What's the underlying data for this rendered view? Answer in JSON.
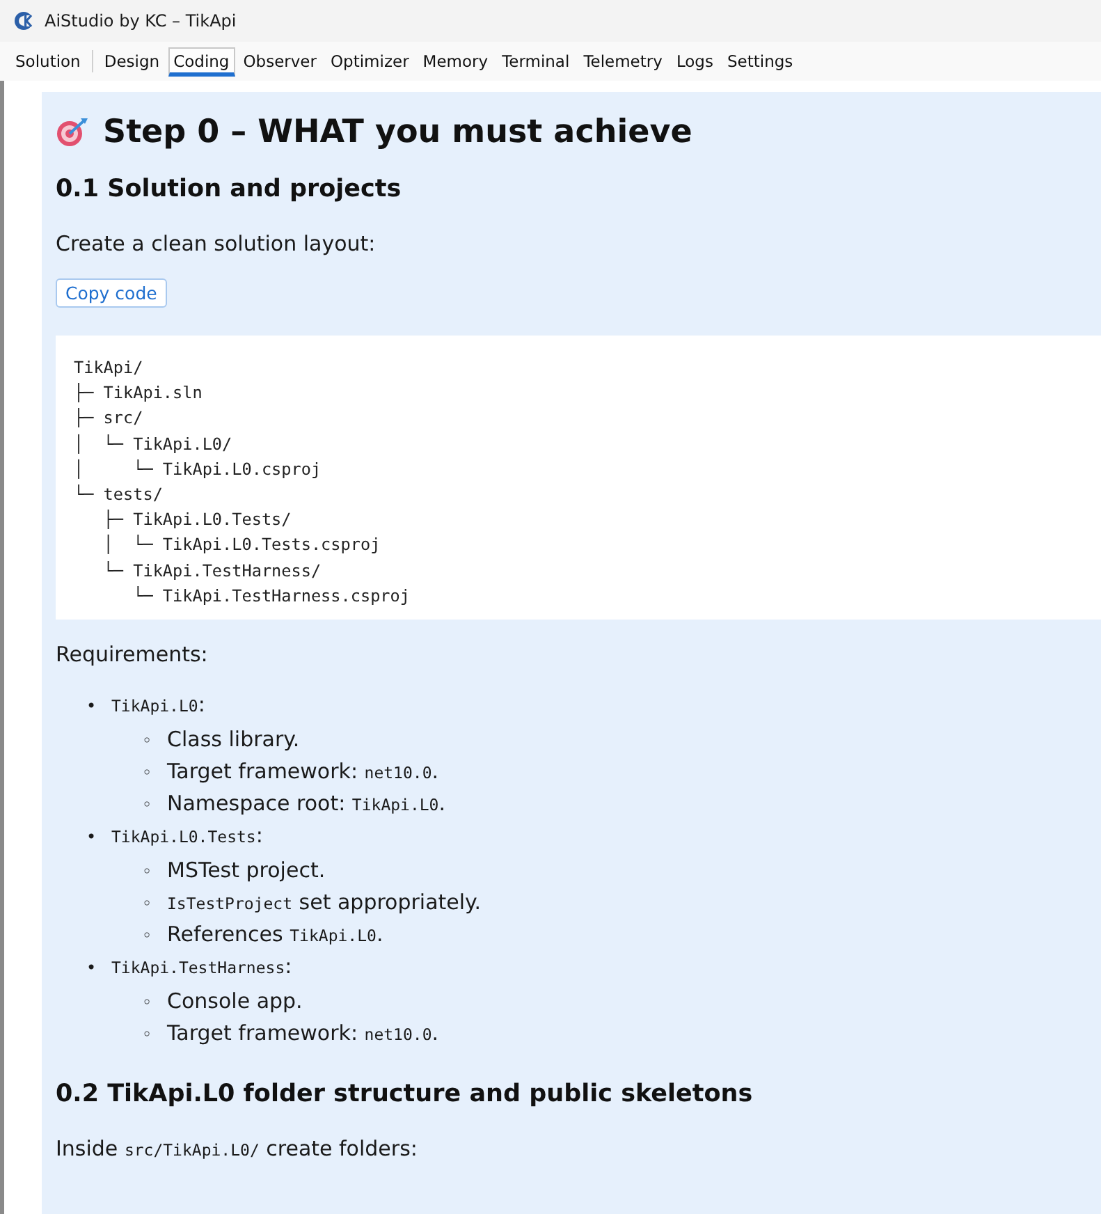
{
  "window": {
    "title": "AiStudio by KC – TikApi"
  },
  "tabs": [
    {
      "label": "Solution",
      "selected": false
    },
    {
      "label": "Design",
      "selected": false
    },
    {
      "label": "Coding",
      "selected": true
    },
    {
      "label": "Observer",
      "selected": false
    },
    {
      "label": "Optimizer",
      "selected": false
    },
    {
      "label": "Memory",
      "selected": false
    },
    {
      "label": "Terminal",
      "selected": false
    },
    {
      "label": "Telemetry",
      "selected": false
    },
    {
      "label": "Logs",
      "selected": false
    },
    {
      "label": "Settings",
      "selected": false
    }
  ],
  "document": {
    "title": "Step 0 – WHAT you must achieve",
    "section_1": {
      "heading": "0.1 Solution and projects",
      "intro": "Create a clean solution layout:",
      "copy_button": "Copy code",
      "code_lines": [
        "TikApi/",
        "├─ TikApi.sln",
        "├─ src/",
        "│  └─ TikApi.L0/",
        "│     └─ TikApi.L0.csproj",
        "└─ tests/",
        "   ├─ TikApi.L0.Tests/",
        "   │  └─ TikApi.L0.Tests.csproj",
        "   └─ TikApi.TestHarness/",
        "      └─ TikApi.TestHarness.csproj"
      ],
      "requirements_label": "Requirements:",
      "requirements": [
        {
          "marker": "•",
          "parts": [
            {
              "text": "TikApi.L0",
              "code": true
            },
            {
              "text": ":",
              "code": false
            }
          ],
          "children": [
            {
              "marker": "◦",
              "parts": [
                {
                  "text": "Class library.",
                  "code": false
                }
              ]
            },
            {
              "marker": "◦",
              "parts": [
                {
                  "text": "Target framework: ",
                  "code": false
                },
                {
                  "text": "net10.0",
                  "code": true
                },
                {
                  "text": ".",
                  "code": false
                }
              ]
            },
            {
              "marker": "◦",
              "parts": [
                {
                  "text": "Namespace root: ",
                  "code": false
                },
                {
                  "text": "TikApi.L0",
                  "code": true
                },
                {
                  "text": ".",
                  "code": false
                }
              ]
            }
          ]
        },
        {
          "marker": "•",
          "parts": [
            {
              "text": "TikApi.L0.Tests",
              "code": true
            },
            {
              "text": ":",
              "code": false
            }
          ],
          "children": [
            {
              "marker": "◦",
              "parts": [
                {
                  "text": "MSTest project.",
                  "code": false
                }
              ]
            },
            {
              "marker": "◦",
              "parts": [
                {
                  "text": "IsTestProject",
                  "code": true
                },
                {
                  "text": " set appropriately.",
                  "code": false
                }
              ]
            },
            {
              "marker": "◦",
              "parts": [
                {
                  "text": "References ",
                  "code": false
                },
                {
                  "text": "TikApi.L0",
                  "code": true
                },
                {
                  "text": ".",
                  "code": false
                }
              ]
            }
          ]
        },
        {
          "marker": "•",
          "parts": [
            {
              "text": "TikApi.TestHarness",
              "code": true
            },
            {
              "text": ":",
              "code": false
            }
          ],
          "children": [
            {
              "marker": "◦",
              "parts": [
                {
                  "text": "Console app.",
                  "code": false
                }
              ]
            },
            {
              "marker": "◦",
              "parts": [
                {
                  "text": "Target framework: ",
                  "code": false
                },
                {
                  "text": "net10.0",
                  "code": true
                },
                {
                  "text": ".",
                  "code": false
                }
              ]
            }
          ]
        }
      ]
    },
    "section_2": {
      "heading": "0.2 TikApi.L0 folder structure and public skeletons",
      "intro_parts": [
        {
          "text": "Inside ",
          "code": false
        },
        {
          "text": "src/TikApi.L0/",
          "code": true
        },
        {
          "text": " create folders:",
          "code": false
        }
      ]
    }
  }
}
